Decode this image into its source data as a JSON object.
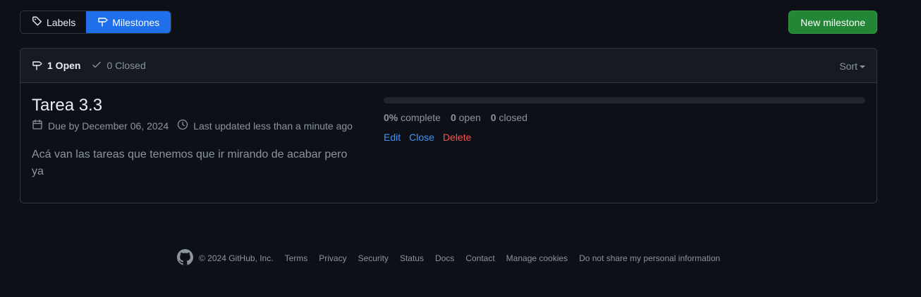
{
  "tabs": {
    "labels": "Labels",
    "milestones": "Milestones"
  },
  "new_milestone_label": "New milestone",
  "header": {
    "open_count": "1 Open",
    "closed_count": "0 Closed",
    "sort_label": "Sort"
  },
  "milestone": {
    "title": "Tarea 3.3",
    "due": "Due by December 06, 2024",
    "updated": "Last updated less than a minute ago",
    "description": "Acá van las tareas que tenemos que ir mirando de acabar pero ya",
    "progress_fraction": 0,
    "complete_value": "0%",
    "complete_label": "complete",
    "open_value": "0",
    "open_label": "open",
    "closed_value": "0",
    "closed_label": "closed",
    "edit": "Edit",
    "close": "Close",
    "delete": "Delete"
  },
  "footer": {
    "copyright": "© 2024 GitHub, Inc.",
    "links": [
      "Terms",
      "Privacy",
      "Security",
      "Status",
      "Docs",
      "Contact",
      "Manage cookies",
      "Do not share my personal information"
    ]
  },
  "colors": {
    "background": "#0d1117",
    "accent": "#1f6feb",
    "primary_button": "#238636",
    "link": "#4493f8",
    "danger": "#f85149"
  },
  "icons": [
    "tag-icon",
    "milestone-icon",
    "check-icon",
    "calendar-icon",
    "clock-icon",
    "github-logo-icon"
  ]
}
